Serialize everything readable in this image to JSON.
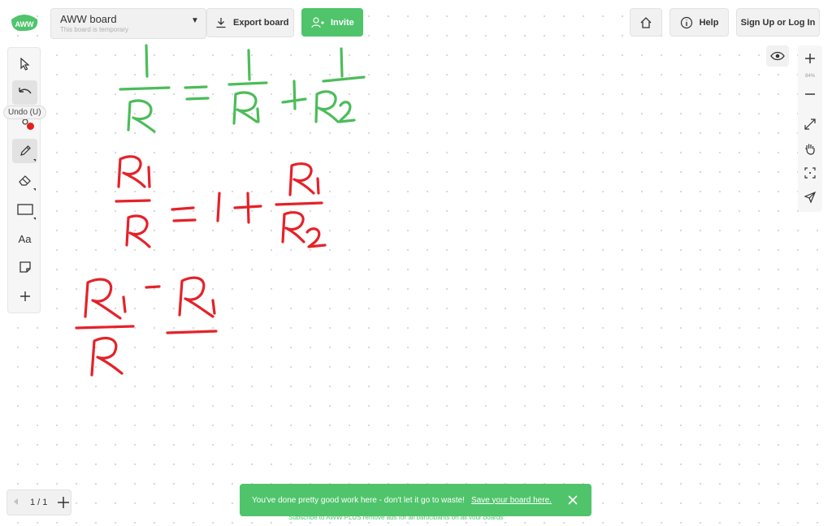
{
  "brand": {
    "logo_text": "AWW",
    "accent": "#4fc46b"
  },
  "header": {
    "board_title": "AWW board",
    "board_subtitle": "This board is temporary",
    "export_label": "Export board",
    "invite_label": "Invite",
    "help_label": "Help",
    "signup_label": "Sign Up or Log In"
  },
  "left_toolbar": {
    "tools": [
      "select-icon",
      "undo-icon",
      "redo-icon",
      "pencil-icon",
      "eraser-icon",
      "rectangle-icon",
      "text-tool",
      "sticky-note-icon",
      "plus-icon"
    ],
    "text_tool_label": "Aa",
    "undo_tooltip": "Undo (U)",
    "active_tool": "pencil"
  },
  "right_toolbar": {
    "zoom_level": "84%",
    "tools": [
      "zoom-in-icon",
      "zoom-out-icon",
      "fullscreen-icon",
      "hand-icon",
      "fit-icon",
      "laser-icon"
    ]
  },
  "pages": {
    "current": "1 / 1"
  },
  "toast": {
    "message": "You've done pretty good work here - don't let it go to waste!",
    "link": "Save your board here."
  },
  "footer": {
    "subscribe_text": "Subscribe to AWW PLUS remove ads for all participants on all your boards"
  },
  "ink_colors": {
    "green": "#4cbc5a",
    "red": "#e52229"
  }
}
